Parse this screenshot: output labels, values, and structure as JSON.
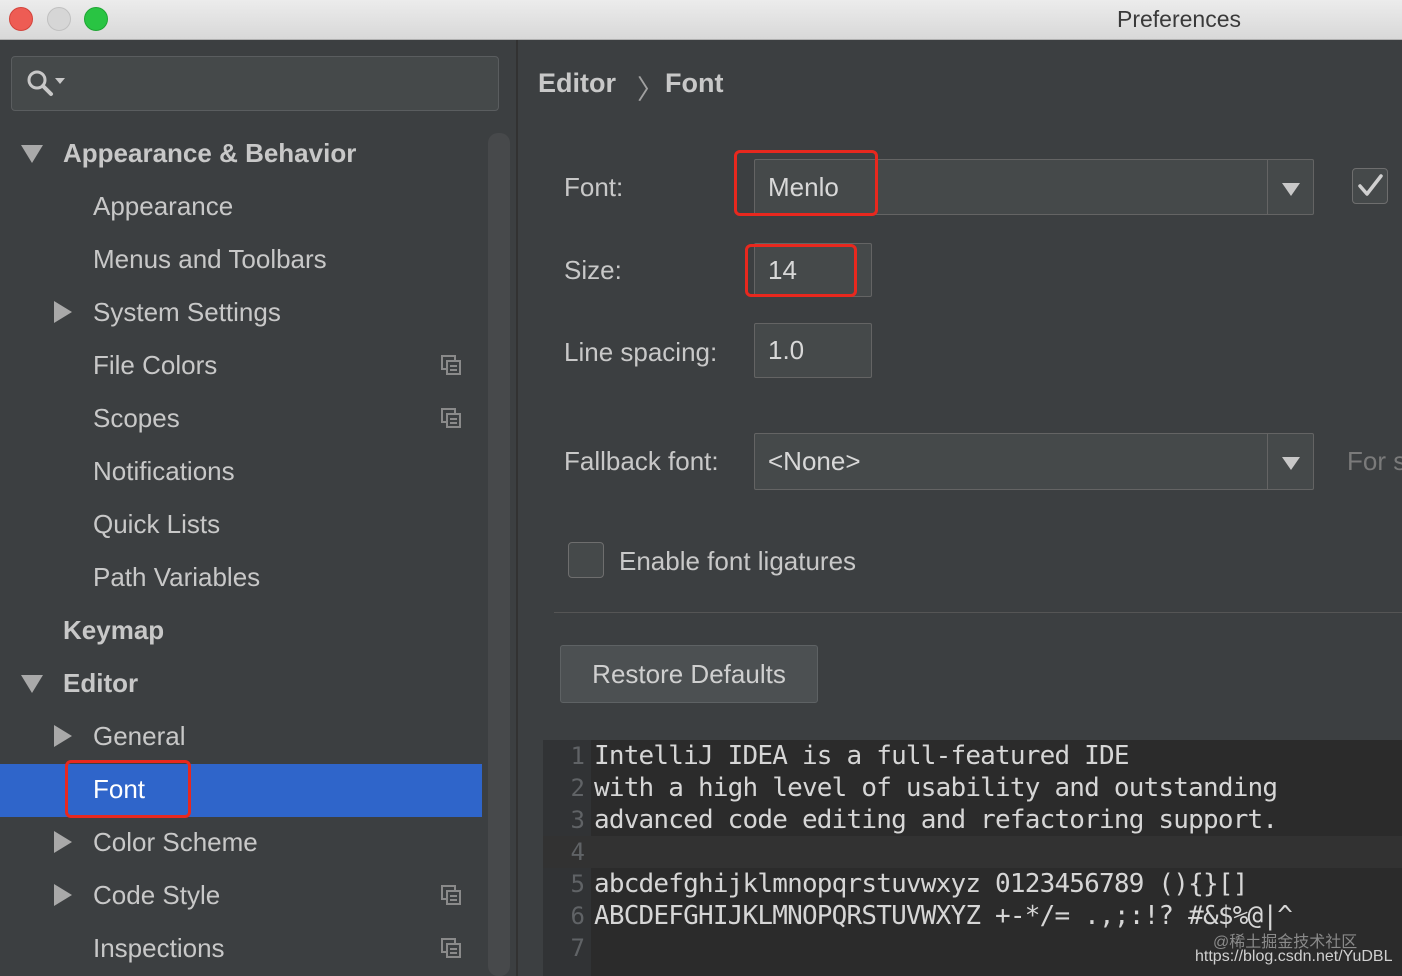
{
  "window": {
    "title": "Preferences",
    "traffic_lights": {
      "close": "#ee5c54",
      "minimize": "#d6d6d6",
      "maximize": "#29c443"
    }
  },
  "colors": {
    "selection": "#2f65ca",
    "highlight_box": "#e8281e",
    "background": "#3c3f41"
  },
  "sidebar": {
    "search": {
      "value": "",
      "icon": "search-dropdown-icon"
    },
    "items": [
      {
        "label": "Appearance & Behavior",
        "expanded": true,
        "bold": true
      },
      {
        "label": "Appearance"
      },
      {
        "label": "Menus and Toolbars"
      },
      {
        "label": "System Settings",
        "expanded": false
      },
      {
        "label": "File Colors",
        "project_icon": true
      },
      {
        "label": "Scopes",
        "project_icon": true
      },
      {
        "label": "Notifications"
      },
      {
        "label": "Quick Lists"
      },
      {
        "label": "Path Variables"
      },
      {
        "label": "Keymap",
        "bold": true
      },
      {
        "label": "Editor",
        "expanded": true,
        "bold": true
      },
      {
        "label": "General",
        "expanded": false
      },
      {
        "label": "Font",
        "selected": true
      },
      {
        "label": "Color Scheme",
        "expanded": false
      },
      {
        "label": "Code Style",
        "expanded": false,
        "project_icon": true
      },
      {
        "label": "Inspections",
        "project_icon": true
      }
    ]
  },
  "breadcrumb": {
    "parent": "Editor",
    "separator": "〉",
    "current": "Font"
  },
  "font_settings": {
    "font_label": "Font:",
    "font_value": "Menlo",
    "show_only_monospaced_checked": true,
    "size_label": "Size:",
    "size_value": "14",
    "line_spacing_label": "Line spacing:",
    "line_spacing_value": "1.0",
    "fallback_label": "Fallback font:",
    "fallback_value": "<None>",
    "fallback_hint": "For s",
    "ligatures_label": "Enable font ligatures",
    "ligatures_checked": false,
    "restore_button": "Restore Defaults"
  },
  "preview": {
    "line_numbers": [
      "1",
      "2",
      "3",
      "4",
      "5",
      "6",
      "7"
    ],
    "lines": [
      "IntelliJ IDEA is a full-featured IDE",
      "with a high level of usability and outstanding",
      "advanced code editing and refactoring support.",
      "",
      "abcdefghijklmnopqrstuvwxyz 0123456789 (){}[]",
      "ABCDEFGHIJKLMNOPQRSTUVWXYZ +-*/= .,;:!? #&$%@|^",
      ""
    ]
  },
  "watermark": {
    "line1": "@稀土掘金技术社区",
    "line2": "https://blog.csdn.net/YuDBL"
  }
}
